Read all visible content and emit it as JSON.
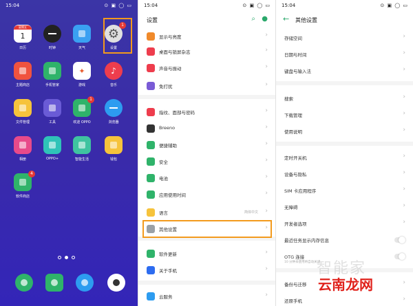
{
  "status": {
    "time": "15:04",
    "net": "3all",
    "right_icons": "⊙ ▣ ◯ ▭"
  },
  "home": {
    "apps": [
      {
        "label": "日历",
        "icon": "calendar-icon",
        "color": "#ffffff",
        "text": "1",
        "toptext": "星期五"
      },
      {
        "label": "时钟",
        "icon": "clock-icon",
        "color": "#222222"
      },
      {
        "label": "天气",
        "icon": "weather-icon",
        "color": "#3aa0f2"
      },
      {
        "label": "设置",
        "icon": "settings-gear-icon",
        "color": "#e0e0e0",
        "badge": "1"
      },
      {
        "label": "主题商店",
        "icon": "theme-store-icon",
        "color": "#f0533f"
      },
      {
        "label": "手机管家",
        "icon": "phone-manager-icon",
        "color": "#2fb36a"
      },
      {
        "label": "游戏",
        "icon": "game-icon",
        "color": "#ffffff"
      },
      {
        "label": "音乐",
        "icon": "music-icon",
        "color": "#ee3d4d"
      },
      {
        "label": "文件管理",
        "icon": "file-manager-icon",
        "color": "#f6c33c"
      },
      {
        "label": "工具",
        "icon": "tools-folder-icon",
        "color": "#6a5bd6"
      },
      {
        "label": "软件商店",
        "icon": "app-store-icon",
        "color": "#2fb36a",
        "badge": "1",
        "label2": "欢迎 OPPO"
      },
      {
        "label": "浏览器",
        "icon": "browser-icon",
        "color": "#2d9cf0"
      },
      {
        "label": "相册",
        "icon": "gallery-icon",
        "color": "#e84a8a"
      },
      {
        "label": "OPPO+",
        "icon": "oppo-plus-icon",
        "color": "#2fc3b8"
      },
      {
        "label": "智能生活",
        "icon": "smart-life-icon",
        "color": "#3fc3a0"
      },
      {
        "label": "钱包",
        "icon": "wallet-icon",
        "color": "#f6c33c"
      },
      {
        "label": "软件商店",
        "icon": "software-store-icon",
        "color": "#2fb36a",
        "badge": "4"
      }
    ],
    "dock": [
      {
        "name": "phone",
        "icon": "phone-icon",
        "color": "#2fb36a"
      },
      {
        "name": "messages",
        "icon": "messages-icon",
        "color": "#2fb36a"
      },
      {
        "name": "browser",
        "icon": "browser-dock-icon",
        "color": "#2d9cf0"
      },
      {
        "name": "camera",
        "icon": "camera-icon",
        "color": "#ffffff"
      }
    ],
    "accent": "#f39a1c"
  },
  "settings": {
    "title": "设置",
    "items": [
      {
        "label": "显示与亮度",
        "color": "#f08a2b"
      },
      {
        "label": "桌面与锁屏杂志",
        "color": "#ee3d4d"
      },
      {
        "label": "声音与振动",
        "color": "#ee3d4d"
      },
      {
        "label": "免打扰",
        "color": "#7a5bd6"
      },
      {
        "label": "指纹、面部与密码",
        "color": "#ee3d4d"
      },
      {
        "label": "Breeno",
        "color": "#333333"
      },
      {
        "label": "便捷辅助",
        "color": "#2fb36a"
      },
      {
        "label": "安全",
        "color": "#2fb36a"
      },
      {
        "label": "电池",
        "color": "#2fb36a"
      },
      {
        "label": "应用使用时间",
        "color": "#2fb36a"
      },
      {
        "label": "语言",
        "color": "#f6c33c",
        "value": "简体中文"
      },
      {
        "label": "其他设置",
        "color": "#9aa0a6"
      },
      {
        "label": "软件更新",
        "color": "#2fb36a"
      },
      {
        "label": "关于手机",
        "color": "#2d6cf0"
      },
      {
        "label": "云服务",
        "color": "#2d9cf0"
      }
    ]
  },
  "other": {
    "title": "其他设置",
    "items": [
      {
        "label": "存储空间"
      },
      {
        "label": "日期与时间"
      },
      {
        "label": "键盘与输入法"
      },
      {
        "label": "搜索"
      },
      {
        "label": "下载管理"
      },
      {
        "label": "使用说明"
      },
      {
        "label": "定时开关机"
      },
      {
        "label": "设备与隐私"
      },
      {
        "label": "SIM 卡应用程序"
      },
      {
        "label": "无障碍"
      },
      {
        "label": "开发者选项"
      },
      {
        "label": "最近任务显示内存信息"
      },
      {
        "label": "OTG 连接",
        "desc": "10 分钟未使用将自动关闭"
      },
      {
        "label": "备份与迁移"
      },
      {
        "label": "还原手机"
      }
    ]
  },
  "watermark": {
    "text": "智能家",
    "text2": "云南龙网"
  }
}
